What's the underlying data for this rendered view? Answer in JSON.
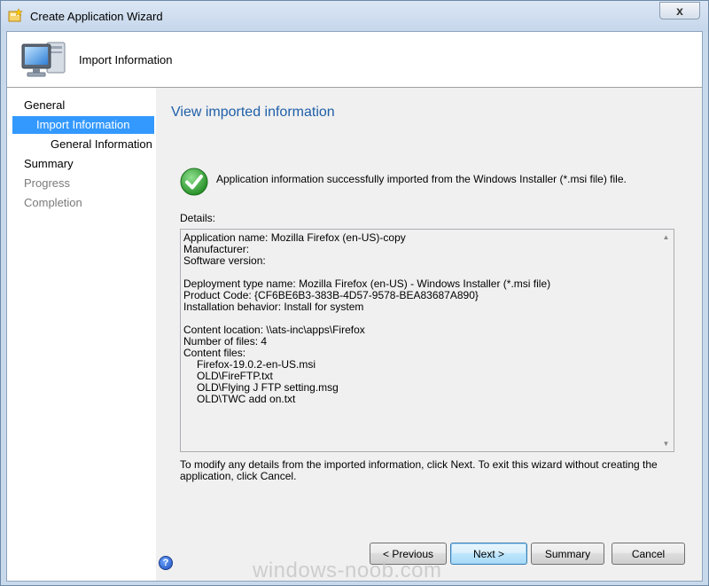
{
  "window": {
    "title": "Create Application Wizard",
    "close_glyph": "x"
  },
  "header": {
    "title": "Import Information",
    "icon": "computer-icon"
  },
  "nav": {
    "items": [
      {
        "label": "General",
        "state": "normal"
      },
      {
        "label": "Import Information",
        "state": "selected"
      },
      {
        "label": "General Information",
        "state": "normal"
      },
      {
        "label": "Summary",
        "state": "normal"
      },
      {
        "label": "Progress",
        "state": "disabled"
      },
      {
        "label": "Completion",
        "state": "disabled"
      }
    ]
  },
  "main": {
    "page_title": "View imported information",
    "success_message": "Application information successfully imported from the Windows Installer (*.msi file) file.",
    "details_label": "Details:",
    "details_lines": [
      "Application name: Mozilla Firefox (en-US)-copy",
      "Manufacturer:",
      "Software version:",
      "",
      "Deployment type name: Mozilla Firefox (en-US) - Windows Installer (*.msi file)",
      "Product Code: {CF6BE6B3-383B-4D57-9578-BEA83687A890}",
      "Installation behavior: Install for system",
      "",
      "Content location: \\\\ats-inc\\apps\\Firefox",
      "Number of files: 4",
      "Content files:",
      "Firefox-19.0.2-en-US.msi",
      "OLD\\FireFTP.txt",
      "OLD\\Flying J FTP setting.msg",
      "OLD\\TWC add on.txt"
    ],
    "info_text": "To modify any details from the imported information, click Next. To exit this wizard without creating the application, click Cancel."
  },
  "footer": {
    "help_glyph": "?",
    "previous_label": "< Previous",
    "next_label": "Next >",
    "summary_label": "Summary",
    "cancel_label": "Cancel"
  },
  "watermark": "windows-noob.com",
  "colors": {
    "selected_nav": "#3399ff",
    "page_title": "#1f5fa8",
    "success_green": "#2e9e2e"
  }
}
